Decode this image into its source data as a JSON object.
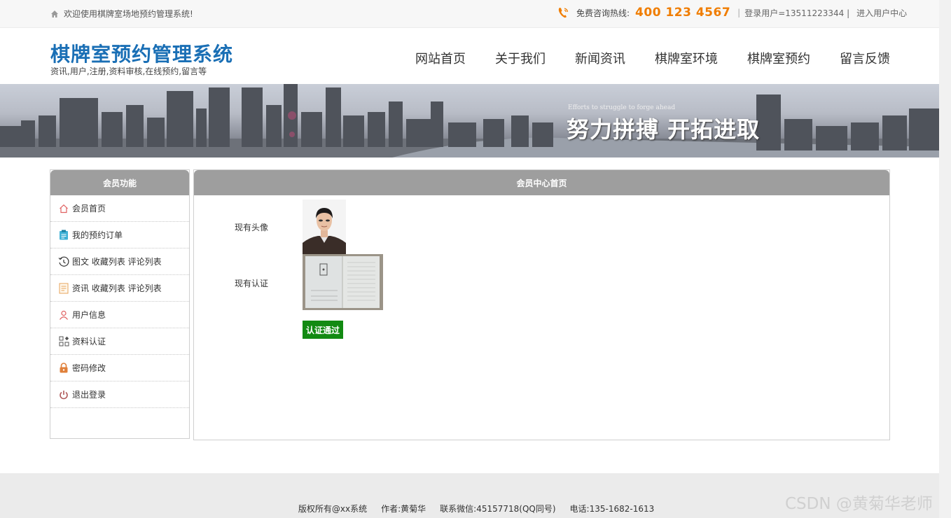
{
  "topbar": {
    "welcome": "欢迎使用棋牌室场地预约管理系统!",
    "hotline_label": "免费咨询热线:",
    "hotline_number": "400 123 4567",
    "login_user": "登录用户=13511223344 |",
    "enter_center": "进入用户中心"
  },
  "header": {
    "title": "棋牌室预约管理系统",
    "subtitle": "资讯,用户,注册,资料审核,在线预约,留言等"
  },
  "nav": [
    "网站首页",
    "关于我们",
    "新闻资讯",
    "棋牌室环境",
    "棋牌室预约",
    "留言反馈"
  ],
  "banner": {
    "slogan_en": "Efforts to struggle to forge ahead",
    "slogan": "努力拼搏 开拓进取"
  },
  "sidebar": {
    "title": "会员功能",
    "items": [
      {
        "label": "会员首页",
        "icon": "home-icon"
      },
      {
        "label": "我的预约订单",
        "icon": "clipboard-icon"
      },
      {
        "label": "图文 收藏列表 评论列表",
        "icon": "history-icon"
      },
      {
        "label": "资讯 收藏列表 评论列表",
        "icon": "document-icon"
      },
      {
        "label": "用户信息",
        "icon": "user-icon"
      },
      {
        "label": "资料认证",
        "icon": "grid-icon"
      },
      {
        "label": "密码修改",
        "icon": "lock-icon"
      },
      {
        "label": "退出登录",
        "icon": "power-icon"
      }
    ]
  },
  "main": {
    "title": "会员中心首页",
    "avatar_label": "现有头像",
    "cert_label": "现有认证",
    "status": "认证通过"
  },
  "footer": {
    "copyright": "版权所有@xx系统",
    "author": "作者:黄菊华",
    "wechat": "联系微信:45157718(QQ同号)",
    "phone": "电话:135-1682-1613"
  },
  "watermark": "CSDN @黄菊华老师",
  "colors": {
    "brand_blue": "#1a6fb5",
    "hotline_orange": "#f07d00",
    "panel_gray": "#9e9e9e",
    "status_green": "#128a12"
  }
}
